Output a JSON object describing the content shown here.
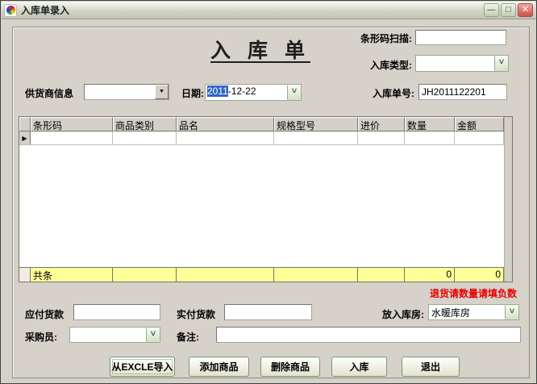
{
  "window": {
    "title": "入库单录入",
    "controls": {
      "minimize": "—",
      "maximize": "□",
      "close": "✕"
    }
  },
  "header": {
    "form_title": "入 库 单",
    "barcode_scan_label": "条形码扫描:",
    "barcode_scan_value": "",
    "entry_type_label": "入库类型:",
    "entry_type_value": ""
  },
  "info_row": {
    "supplier_label": "供货商信息",
    "supplier_value": "",
    "date_label": "日期:",
    "date_selected": "2011",
    "date_rest": "-12-22",
    "entry_no_label": "入库单号:",
    "entry_no_value": "JH2011122201"
  },
  "grid": {
    "columns": [
      "条形码",
      "商品类别",
      "品名",
      "规格型号",
      "进价",
      "数量",
      "金额"
    ],
    "row_selector_glyph": "▶",
    "summary": {
      "label": "共条",
      "qty_total": "0",
      "amount_total": "0"
    }
  },
  "notice": "退货请数量请填负数",
  "footer": {
    "payable_label": "应付货款",
    "payable_value": "",
    "paid_label": "实付货款",
    "paid_value": "",
    "warehouse_label": "放入库房:",
    "warehouse_value": "水暖库房",
    "purchaser_label": "采购员:",
    "purchaser_value": "",
    "remarks_label": "备注:",
    "remarks_value": ""
  },
  "buttons": [
    {
      "label": "从EXCLE导入"
    },
    {
      "label": "添加商品"
    },
    {
      "label": "删除商品"
    },
    {
      "label": "入库"
    },
    {
      "label": "退出"
    }
  ],
  "combo_arrow_glyph": "˅",
  "classic_arrow_glyph": "▼",
  "colors": {
    "window_bg": "#d6d2ca",
    "accent_green_border": "#93ad8d",
    "summary_yellow": "#ffff99",
    "notice_red": "#e60000",
    "selection_blue": "#3166c5",
    "close_red": "#ce5047"
  }
}
